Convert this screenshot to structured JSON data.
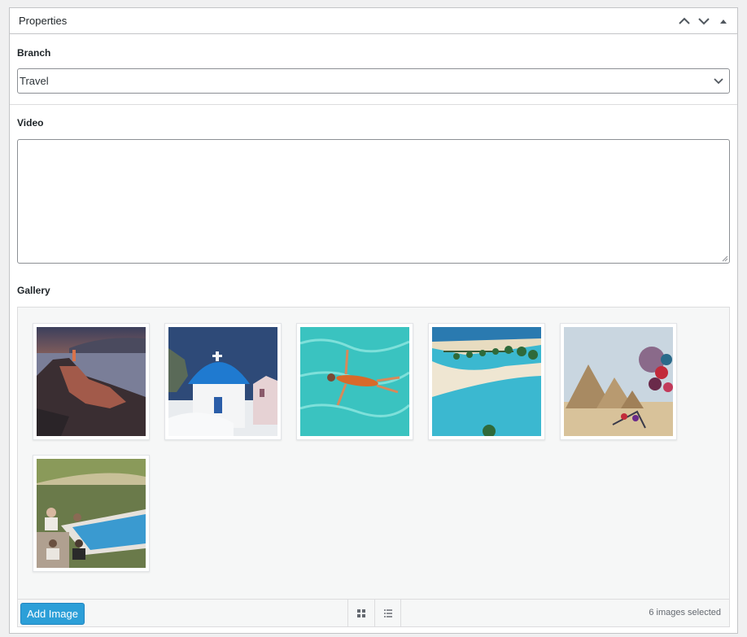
{
  "metabox": {
    "title": "Properties",
    "controls": [
      "chevron-up-icon",
      "chevron-down-icon",
      "triangle-up-icon"
    ]
  },
  "branch": {
    "label": "Branch",
    "selected": "Travel"
  },
  "video": {
    "label": "Video",
    "value": ""
  },
  "gallery": {
    "label": "Gallery",
    "images": [
      {
        "subject": "cliffside village at sunset"
      },
      {
        "subject": "blue dome church"
      },
      {
        "subject": "swimmer in turquoise water"
      },
      {
        "subject": "tropical beach with palms"
      },
      {
        "subject": "pyramids with souvenirs"
      },
      {
        "subject": "people relaxing by pool"
      }
    ],
    "add_button": "Add Image",
    "view_buttons": [
      "grid-view-icon",
      "list-view-icon"
    ],
    "selected_text": "6 images selected"
  },
  "colors": {
    "accent": "#2c9fd8",
    "border": "#c3c4c7"
  }
}
